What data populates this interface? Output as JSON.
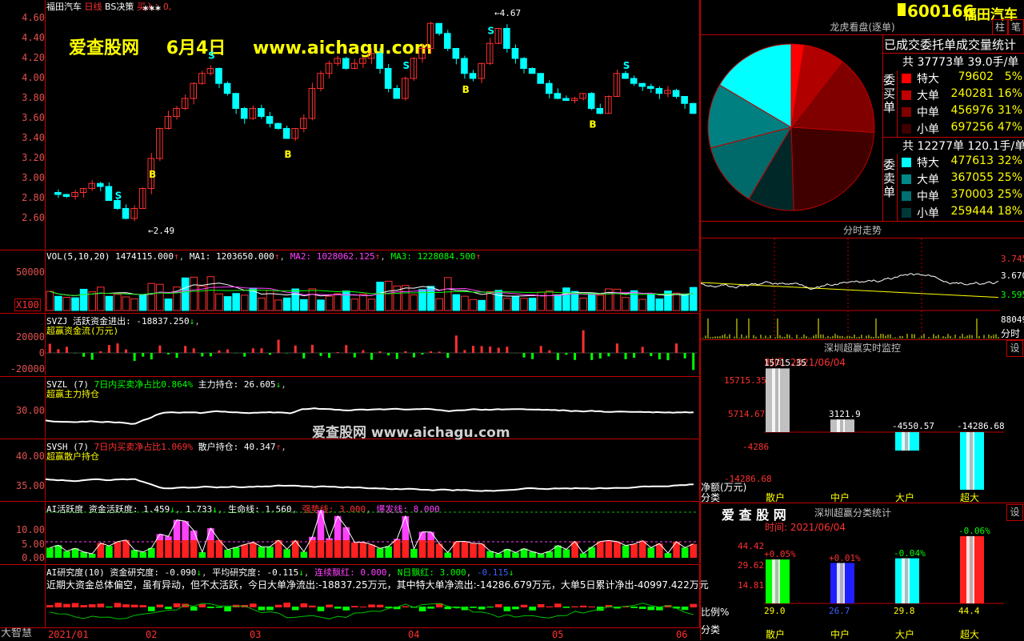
{
  "main_chart": {
    "header": {
      "name": "福田汽车",
      "period": "日线",
      "indicator": "BS决策",
      "buy_label": "买入：0,"
    },
    "y_ticks": [
      "4.60",
      "4.40",
      "4.20",
      "4.00",
      "3.80",
      "3.60",
      "3.40",
      "3.20",
      "3.00",
      "2.80",
      "2.60"
    ],
    "watermark": {
      "site": "爱查股网",
      "date": "6月4日",
      "url": "www.aichagu.com"
    },
    "high_label": "4.67",
    "low_label": "2.49",
    "signals": {
      "buy": "B",
      "sell": "S"
    },
    "stars": "***"
  },
  "vol_pane": {
    "label": "VOL(5,10,20)",
    "vol": "1474115.000",
    "ma1": "MA1: 1203650.000",
    "ma2": "MA2: 1028062.125",
    "ma3": "MA3: 1228084.500",
    "y_tick": "50000",
    "unit": "X100"
  },
  "svzj_pane": {
    "label": "SVZJ",
    "text": "活跃资金进出: -18837.250",
    "subtitle": "超赢资金流(万元)",
    "y_ticks": [
      "20000",
      "0",
      "-20000"
    ]
  },
  "svzl_pane": {
    "label": "SVZL (7)",
    "text1": "7日内买卖净占比0.864%",
    "text2": "主力持仓: 26.605",
    "subtitle": "超赢主力持仓",
    "y_ticks": [
      "30.00"
    ],
    "watermark": "爱查股网  www.aichagu.com"
  },
  "svsh_pane": {
    "label": "SVSH (7)",
    "text1": "7日内买卖净占比1.069%",
    "text2": "散户持仓: 40.347",
    "subtitle": "超赢散户持仓",
    "y_ticks": [
      "40.00",
      "35.00"
    ]
  },
  "ai_act_pane": {
    "label": "AI活跃度",
    "text1": "资金活跃度: 1.459",
    "text2": "1.733",
    "text3": "生命线: 1.560",
    "text4": "强势线: 3.000",
    "text5": "爆发线: 8.000",
    "y_ticks": [
      "10.00",
      "5.00",
      "0.00"
    ]
  },
  "ai_res_pane": {
    "label": "AI研究度(10)",
    "text1": "资金研究度: -0.090",
    "text2": "平均研究度: -0.115",
    "text3": "连续飘红: 0.000",
    "text4": "N日飘红: 3.000",
    "text5": "-0.115",
    "summary": "近期大资金总体偏空，虽有异动，但不太活跃，今日大单净流出:-18837.25万元，其中特大单净流出:-14286.679万元，大单5日累计净出-40997.422万元",
    "left_label": "大智慧"
  },
  "x_axis": [
    "2021/01",
    "02",
    "03",
    "04",
    "05",
    "06"
  ],
  "right_panel": {
    "code": "600166",
    "name": "福田汽车",
    "btn_zhu": "柱",
    "btn_bi": "笔",
    "dragon_title": "龙虎看盘(逐单)",
    "stats_title": "已成交委托单成交量统计",
    "buy_group": "委买单",
    "sell_group": "委卖单",
    "buy_total": "共 37773单 39.0手/单",
    "sell_total": "共 12277单 120.1手/单",
    "buy_rows": [
      {
        "label": "特大",
        "value": "79602",
        "pct": "5%",
        "color": "#ff0000"
      },
      {
        "label": "大单",
        "value": "240281",
        "pct": "16%",
        "color": "#c00000"
      },
      {
        "label": "中单",
        "value": "456976",
        "pct": "31%",
        "color": "#800000"
      },
      {
        "label": "小单",
        "value": "697256",
        "pct": "47%",
        "color": "#400000"
      }
    ],
    "sell_rows": [
      {
        "label": "特大",
        "value": "477613",
        "pct": "32%",
        "color": "#00ffff"
      },
      {
        "label": "大单",
        "value": "367055",
        "pct": "25%",
        "color": "#008888"
      },
      {
        "label": "中单",
        "value": "370003",
        "pct": "25%",
        "color": "#007070"
      },
      {
        "label": "小单",
        "value": "259444",
        "pct": "18%",
        "color": "#003838"
      }
    ],
    "pie": {
      "slices": [
        {
          "name": "买特大",
          "pct": 2.5,
          "color": "#ff0000"
        },
        {
          "name": "买大单",
          "pct": 8.0,
          "color": "#b00000"
        },
        {
          "name": "买中单",
          "pct": 15.5,
          "color": "#800000"
        },
        {
          "name": "买小单",
          "pct": 23.5,
          "color": "#400000"
        },
        {
          "name": "卖小单",
          "pct": 9.0,
          "color": "#002828"
        },
        {
          "name": "卖中单",
          "pct": 12.5,
          "color": "#006a6a"
        },
        {
          "name": "卖大单",
          "pct": 12.5,
          "color": "#008080"
        },
        {
          "name": "卖特大",
          "pct": 16.5,
          "color": "#00ffff"
        }
      ]
    },
    "intraday_title": "分时走势",
    "intraday_ticks": [
      "3.745",
      "3.670",
      "3.595",
      "88049"
    ],
    "intraday_vol_label": "分时",
    "monitor": {
      "title": "深圳超赢实时监控",
      "set_btn": "设",
      "time": "时间: 2021/06/04",
      "y_ticks": [
        "15715.35",
        "5714.67",
        "-4286",
        "-14286.68"
      ],
      "y_unit": "净额(万元)",
      "x_title": "分类",
      "categories": [
        "散户",
        "中户",
        "大户",
        "超大"
      ],
      "values": [
        15715.35,
        3121.9,
        -4550.57,
        -14286.68
      ],
      "value_labels": [
        "15715.35",
        "3121.9",
        "-4550.57",
        "-14286.68"
      ]
    },
    "classify": {
      "brand": "爱 查 股 网",
      "title": "深圳超赢分类统计",
      "set_btn": "设",
      "time": "时间: 2021/06/04",
      "y_ticks": [
        "44.42",
        "29.62",
        "14.81"
      ],
      "y_unit": "比例%",
      "x_title": "分类",
      "categories": [
        "散户",
        "中户",
        "大户",
        "超大"
      ],
      "values": [
        29.0,
        26.7,
        29.8,
        44.4
      ],
      "changes": [
        "+0.05%",
        "+0.01%",
        "-0.04%",
        "-0.06%"
      ],
      "colors": [
        "#00ff00",
        "#2020ff",
        "#00ffff",
        "#ff2020"
      ]
    }
  },
  "chart_data": {
    "type": "bar",
    "title": "深圳超赢实时监控",
    "categories": [
      "散户",
      "中户",
      "大户",
      "超大"
    ],
    "series": [
      {
        "name": "净额(万元)",
        "values": [
          15715.35,
          3121.9,
          -4550.57,
          -14286.68
        ]
      },
      {
        "name": "比例%",
        "values": [
          29.0,
          26.7,
          29.8,
          44.4
        ]
      }
    ]
  }
}
